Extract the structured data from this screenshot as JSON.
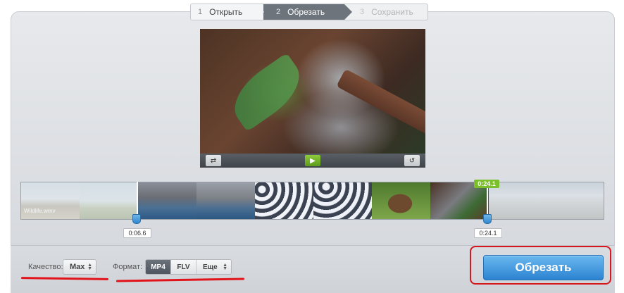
{
  "steps": [
    {
      "num": "1",
      "label": "Открыть"
    },
    {
      "num": "2",
      "label": "Обрезать"
    },
    {
      "num": "3",
      "label": "Сохранить"
    }
  ],
  "player": {
    "loop_icon": "loop-icon",
    "play_icon": "play-icon",
    "reset_icon": "reset-icon"
  },
  "timeline": {
    "watermark": "Wildlife.wmv",
    "start_time": "0:06.6",
    "end_time": "0:24.1",
    "end_flag": "0:24.1"
  },
  "settings": {
    "quality_label": "Качество:",
    "quality_value": "Max",
    "format_label": "Формат:",
    "format_options": [
      "MP4",
      "FLV",
      "Еще"
    ],
    "selected_format": "MP4"
  },
  "cut_button_label": "Обрезать",
  "colors": {
    "accent_blue": "#2c83d1",
    "play_green": "#7bbf2c",
    "highlight_red": "#e0141a"
  }
}
